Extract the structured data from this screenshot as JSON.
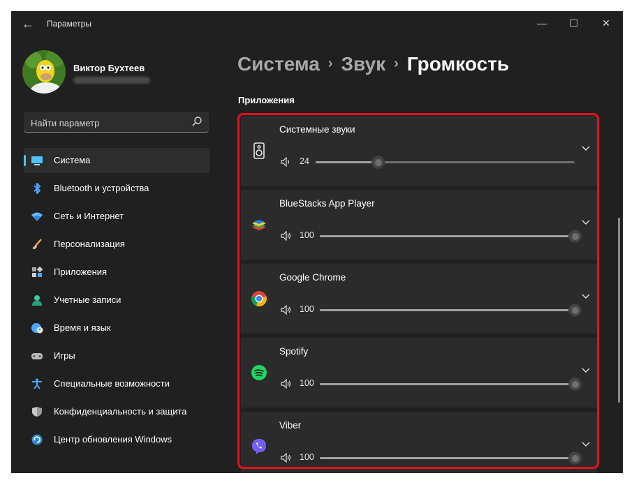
{
  "window": {
    "title": "Параметры"
  },
  "user": {
    "name": "Виктор Бухтеев"
  },
  "search": {
    "placeholder": "Найти параметр"
  },
  "nav": [
    {
      "label": "Система",
      "icon": "system-icon",
      "active": true
    },
    {
      "label": "Bluetooth и устройства",
      "icon": "bluetooth-icon"
    },
    {
      "label": "Сеть и Интернет",
      "icon": "wifi-icon"
    },
    {
      "label": "Персонализация",
      "icon": "brush-icon"
    },
    {
      "label": "Приложения",
      "icon": "apps-icon"
    },
    {
      "label": "Учетные записи",
      "icon": "person-icon"
    },
    {
      "label": "Время и язык",
      "icon": "globe-clock-icon"
    },
    {
      "label": "Игры",
      "icon": "gamepad-icon"
    },
    {
      "label": "Специальные возможности",
      "icon": "accessibility-icon"
    },
    {
      "label": "Конфиденциальность и защита",
      "icon": "shield-icon"
    },
    {
      "label": "Центр обновления Windows",
      "icon": "update-icon"
    }
  ],
  "breadcrumb": {
    "part1": "Система",
    "part2": "Звук",
    "part3": "Громкость",
    "separator": "›"
  },
  "section": {
    "title": "Приложения"
  },
  "apps": [
    {
      "name": "Системные звуки",
      "volume": 24,
      "icon": "speaker-device-icon"
    },
    {
      "name": "BlueStacks App Player",
      "volume": 100,
      "icon": "bluestacks-icon"
    },
    {
      "name": "Google Chrome",
      "volume": 100,
      "icon": "chrome-icon"
    },
    {
      "name": "Spotify",
      "volume": 100,
      "icon": "spotify-icon"
    },
    {
      "name": "Viber",
      "volume": 100,
      "icon": "viber-icon"
    }
  ],
  "colors": {
    "accent": "#4cc2ff",
    "highlight": "#e3121c",
    "background": "#202020",
    "card": "#2b2b2b"
  }
}
